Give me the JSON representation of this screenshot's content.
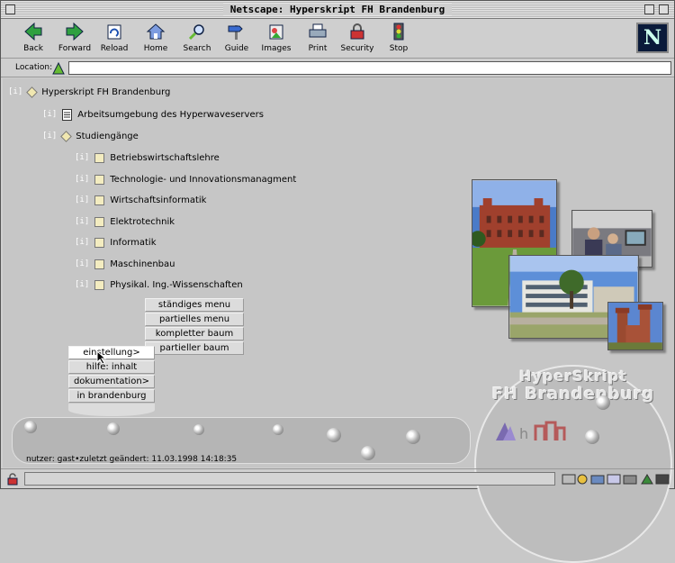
{
  "window": {
    "title": "Netscape: Hyperskript FH Brandenburg"
  },
  "toolbar": {
    "buttons": [
      {
        "label": "Back",
        "icon": "back-arrow-icon"
      },
      {
        "label": "Forward",
        "icon": "forward-arrow-icon"
      },
      {
        "label": "Reload",
        "icon": "reload-icon"
      },
      {
        "label": "Home",
        "icon": "home-icon"
      },
      {
        "label": "Search",
        "icon": "search-icon"
      },
      {
        "label": "Guide",
        "icon": "guide-icon"
      },
      {
        "label": "Images",
        "icon": "images-icon"
      },
      {
        "label": "Print",
        "icon": "print-icon"
      },
      {
        "label": "Security",
        "icon": "security-lock-icon"
      },
      {
        "label": "Stop",
        "icon": "stop-icon"
      }
    ],
    "logo": "N"
  },
  "location": {
    "label": "Location:",
    "value": ""
  },
  "tree": [
    {
      "bracket": "[i]",
      "icon": "diamond",
      "label": "Hyperskript FH Brandenburg"
    },
    {
      "bracket": "[i]",
      "icon": "document",
      "label": "Arbeitsumgebung des Hyperwaveservers"
    },
    {
      "bracket": "[i]",
      "icon": "diamond",
      "label": "Studiengänge"
    },
    {
      "bracket": "[i]",
      "icon": "square",
      "label": "Betriebswirtschaftslehre"
    },
    {
      "bracket": "[i]",
      "icon": "square",
      "label": "Technologie- und Innovationsmanagment"
    },
    {
      "bracket": "[i]",
      "icon": "square",
      "label": "Wirtschaftsinformatik"
    },
    {
      "bracket": "[i]",
      "icon": "square",
      "label": "Elektrotechnik"
    },
    {
      "bracket": "[i]",
      "icon": "square",
      "label": "Informatik"
    },
    {
      "bracket": "[i]",
      "icon": "square",
      "label": "Maschinenbau"
    },
    {
      "bracket": "[i]",
      "icon": "square",
      "label": "Physikal. Ing.-Wissenschaften"
    }
  ],
  "submenu": [
    "ständiges menu",
    "partielles menu",
    "kompletter baum",
    "partieller baum"
  ],
  "mainmenu": [
    "einstellung>",
    "hilfe: inhalt",
    "dokumentation>",
    "in brandenburg"
  ],
  "brand": {
    "line1": "HyperSkript",
    "line2": "FH Brandenburg"
  },
  "status": {
    "user_line": "nutzer: gast•zuletzt geändert: 11.03.1998 14:18:35"
  },
  "colors": {
    "background": "#c6c6c6",
    "brick": "#a0402d",
    "sky": "#4a7bc8",
    "grass": "#6b9a3a"
  }
}
